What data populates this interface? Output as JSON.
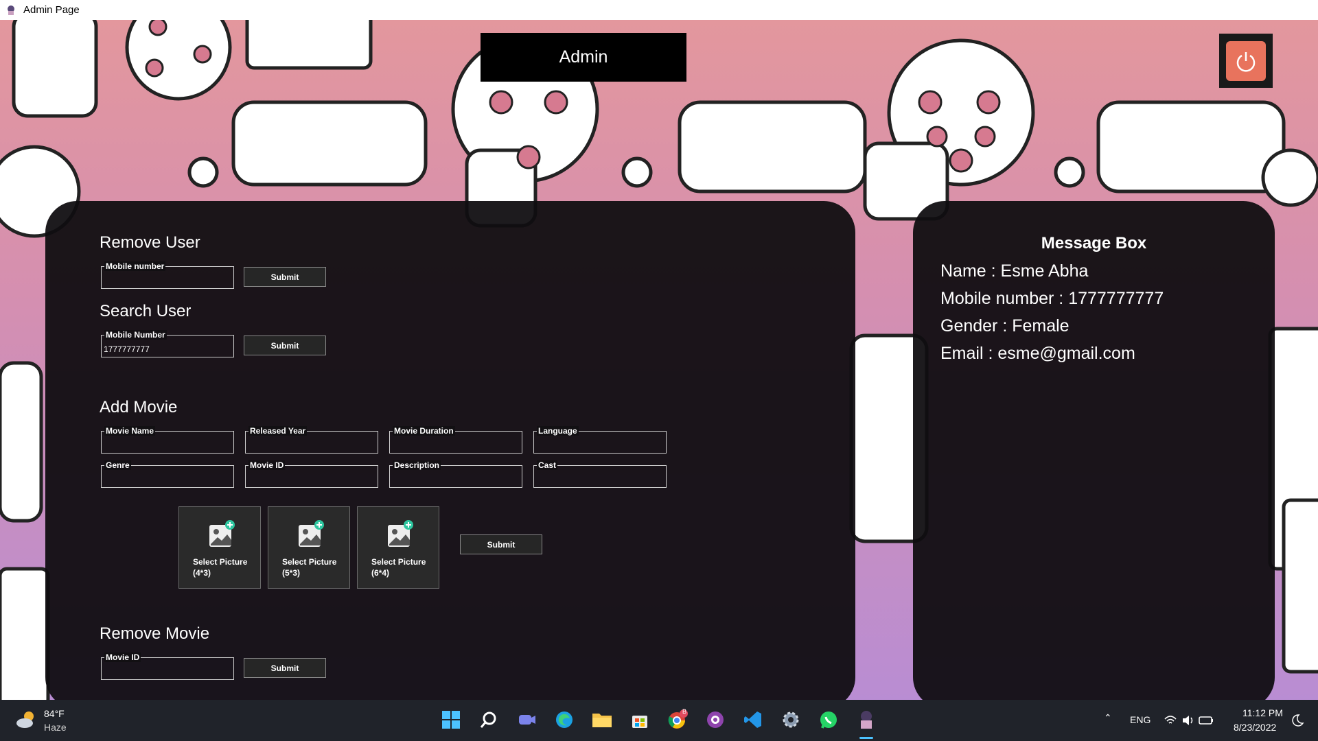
{
  "window": {
    "title": "Admin Page"
  },
  "header": {
    "admin_label": "Admin"
  },
  "remove_user": {
    "heading": "Remove User",
    "mobile_label": "Mobile number",
    "mobile_value": "",
    "submit_label": "Submit"
  },
  "search_user": {
    "heading": "Search User",
    "mobile_label": "Mobile Number",
    "mobile_value": "1777777777",
    "submit_label": "Submit"
  },
  "add_movie": {
    "heading": "Add Movie",
    "fields": [
      {
        "label": "Movie Name"
      },
      {
        "label": "Released Year"
      },
      {
        "label": "Movie Duration"
      },
      {
        "label": "Language"
      },
      {
        "label": "Genre"
      },
      {
        "label": "Movie ID"
      },
      {
        "label": "Description"
      },
      {
        "label": "Cast"
      }
    ],
    "pictures": [
      {
        "label": "Select Picture\n(4*3)"
      },
      {
        "label": "Select Picture\n(5*3)"
      },
      {
        "label": "Select Picture\n(6*4)"
      }
    ],
    "submit_label": "Submit"
  },
  "remove_movie": {
    "heading": "Remove Movie",
    "id_label": "Movie ID",
    "submit_label": "Submit"
  },
  "message_box": {
    "title": "Message Box",
    "lines": [
      "Name : Esme Abha",
      "Mobile number : 1777777777",
      "Gender : Female",
      "Email : esme@gmail.com"
    ]
  },
  "taskbar": {
    "weather_temp": "84°F",
    "weather_desc": "Haze",
    "language": "ENG",
    "time": "11:12 PM",
    "date": "8/23/2022",
    "chrome_badge": "B"
  },
  "colors": {
    "power_button": "#e8735d",
    "panel": "#0f0d10",
    "taskbar": "#20232a"
  }
}
